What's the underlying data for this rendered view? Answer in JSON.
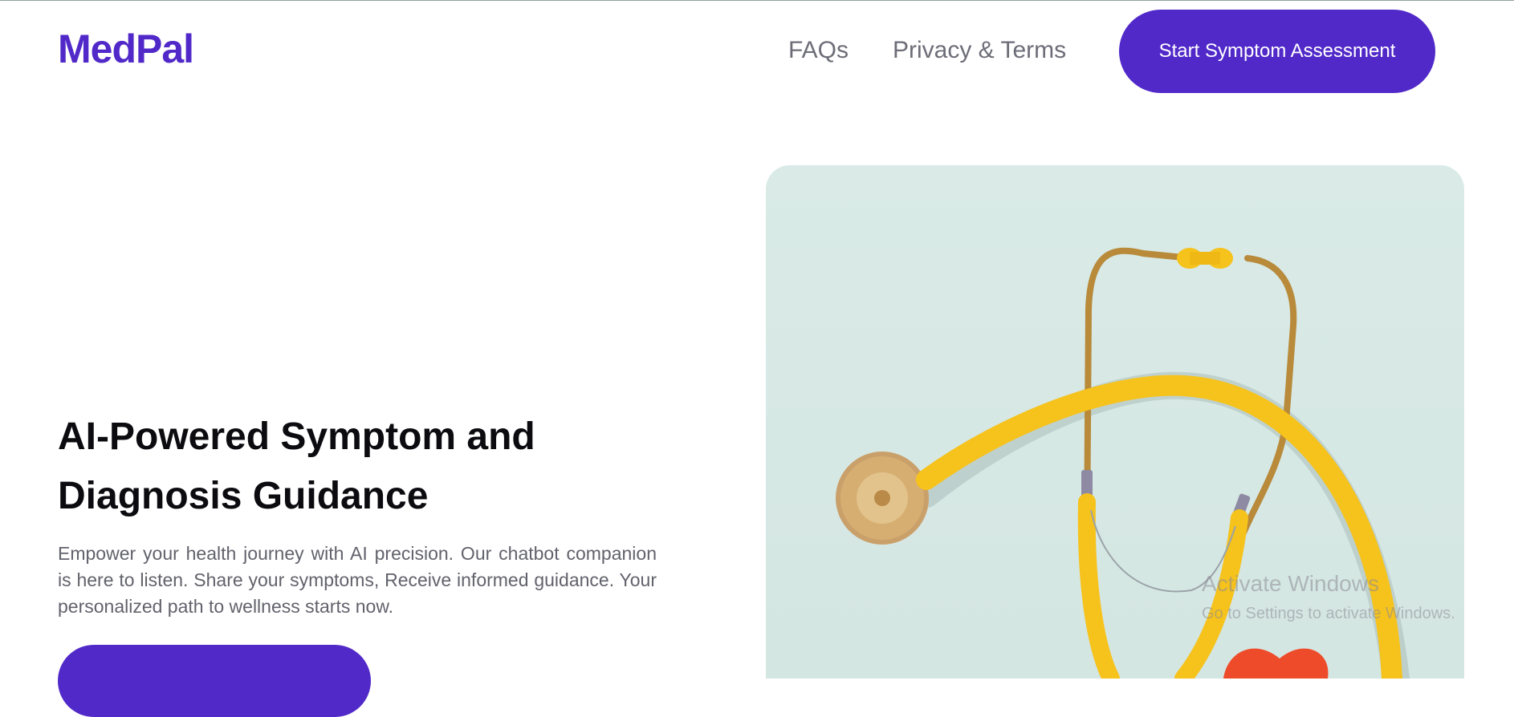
{
  "header": {
    "logo": "MedPal",
    "nav": [
      {
        "label": "FAQs"
      },
      {
        "label": "Privacy & Terms"
      }
    ],
    "cta_label": "Start Symptom Assessment"
  },
  "hero": {
    "title_line1": "AI-Powered Symptom and",
    "title_line2": "Diagnosis Guidance",
    "description": "Empower your health journey with AI precision. Our chatbot companion is here to listen. Share your symptoms, Receive informed guidance. Your personalized path to wellness starts now.",
    "image_icon": "stethoscope-photo"
  },
  "watermark": {
    "title": "Activate Windows",
    "subtitle": "Go to Settings to activate Windows."
  },
  "colors": {
    "brand": "#5129c9",
    "nav_text": "#6d6d78",
    "image_bg": "#d9eae7",
    "tube": "#f6c21c"
  }
}
